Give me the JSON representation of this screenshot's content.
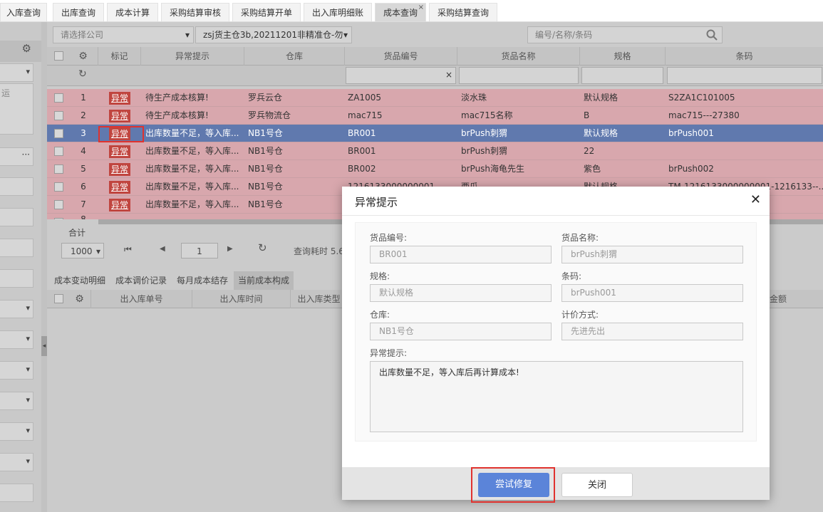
{
  "tabs": [
    {
      "label": "入库查询"
    },
    {
      "label": "出库查询"
    },
    {
      "label": "成本计算"
    },
    {
      "label": "采购结算审核"
    },
    {
      "label": "采购结算开单"
    },
    {
      "label": "出入库明细账"
    },
    {
      "label": "成本查询",
      "active": true
    },
    {
      "label": "采购结算查询"
    }
  ],
  "tab_close_glyph": "×",
  "sidebar": {
    "partial_text": "运",
    "ellipsis": "···"
  },
  "filters": {
    "company_placeholder": "请选择公司",
    "warehouse_value": "zsj货主仓3b,20211201非精准仓-勿",
    "search_placeholder": "编号/名称/条码"
  },
  "grid": {
    "headers": {
      "mark": "标记",
      "exception": "异常提示",
      "warehouse": "仓库",
      "code": "货品编号",
      "name": "货品名称",
      "spec": "规格",
      "barcode": "条码"
    },
    "clear_glyph": "×",
    "badge_label": "异常",
    "rows": [
      {
        "num": "1",
        "exception": "待生产成本核算!",
        "warehouse": "罗兵云仓",
        "code": "ZA1005",
        "name": "淡水珠",
        "spec": "默认规格",
        "barcode": "S2ZA1C101005"
      },
      {
        "num": "2",
        "exception": "待生产成本核算!",
        "warehouse": "罗兵物流仓",
        "code": "mac715",
        "name": "mac715名称",
        "spec": "B",
        "barcode": "mac715---27380"
      },
      {
        "num": "3",
        "exception": "出库数量不足，等入库...",
        "warehouse": "NB1号仓",
        "code": "BR001",
        "name": "brPush刺猬",
        "spec": "默认规格",
        "barcode": "brPush001",
        "selected": true
      },
      {
        "num": "4",
        "exception": "出库数量不足，等入库...",
        "warehouse": "NB1号仓",
        "code": "BR001",
        "name": "brPush刺猬",
        "spec": "22",
        "barcode": ""
      },
      {
        "num": "5",
        "exception": "出库数量不足，等入库...",
        "warehouse": "NB1号仓",
        "code": "BR002",
        "name": "brPush海龟先生",
        "spec": "紫色",
        "barcode": "brPush002"
      },
      {
        "num": "6",
        "exception": "出库数量不足，等入库...",
        "warehouse": "NB1号仓",
        "code": "1216133000000001",
        "name": "西瓜",
        "spec": "默认规格",
        "barcode": "TM-1216133000000001-1216133--..."
      },
      {
        "num": "7",
        "exception": "出库数量不足，等入库...",
        "warehouse": "NB1号仓",
        "code": "",
        "name": "",
        "spec": "",
        "barcode": ""
      },
      {
        "num": "8",
        "exception": "",
        "warehouse": "",
        "code": "",
        "name": "",
        "spec": "",
        "barcode": ""
      }
    ],
    "total_label": "合计"
  },
  "pager": {
    "page_size": "1000",
    "current_page": "1",
    "query_time": "查询耗时 5.6"
  },
  "subtabs": [
    {
      "label": "成本变动明细"
    },
    {
      "label": "成本调价记录"
    },
    {
      "label": "每月成本结存"
    },
    {
      "label": "当前成本构成",
      "active": true
    }
  ],
  "subgrid_headers": {
    "doc_no": "出入库单号",
    "time": "出入库时间",
    "type": "出入库类型",
    "amount": "金额"
  },
  "modal": {
    "title": "异常提示",
    "close_glyph": "✕",
    "fields": {
      "code": {
        "label": "货品编号:",
        "value": "BR001"
      },
      "name": {
        "label": "货品名称:",
        "value": "brPush刺猬"
      },
      "spec": {
        "label": "规格:",
        "value": "默认规格"
      },
      "barcode": {
        "label": "条码:",
        "value": "brPush001"
      },
      "warehouse": {
        "label": "仓库:",
        "value": "NB1号仓"
      },
      "pricing": {
        "label": "计价方式:",
        "value": "先进先出"
      }
    },
    "exception_label": "异常提示:",
    "exception_text": "出库数量不足，等入库后再计算成本!",
    "try_fix_label": "尝试修复",
    "close_label": "关闭"
  },
  "colors": {
    "accent": "#5b84d9",
    "highlight": "#e0322e",
    "error_row": "#d8a7ad",
    "selected_row": "#6079ae",
    "badge": "#c0453f"
  }
}
